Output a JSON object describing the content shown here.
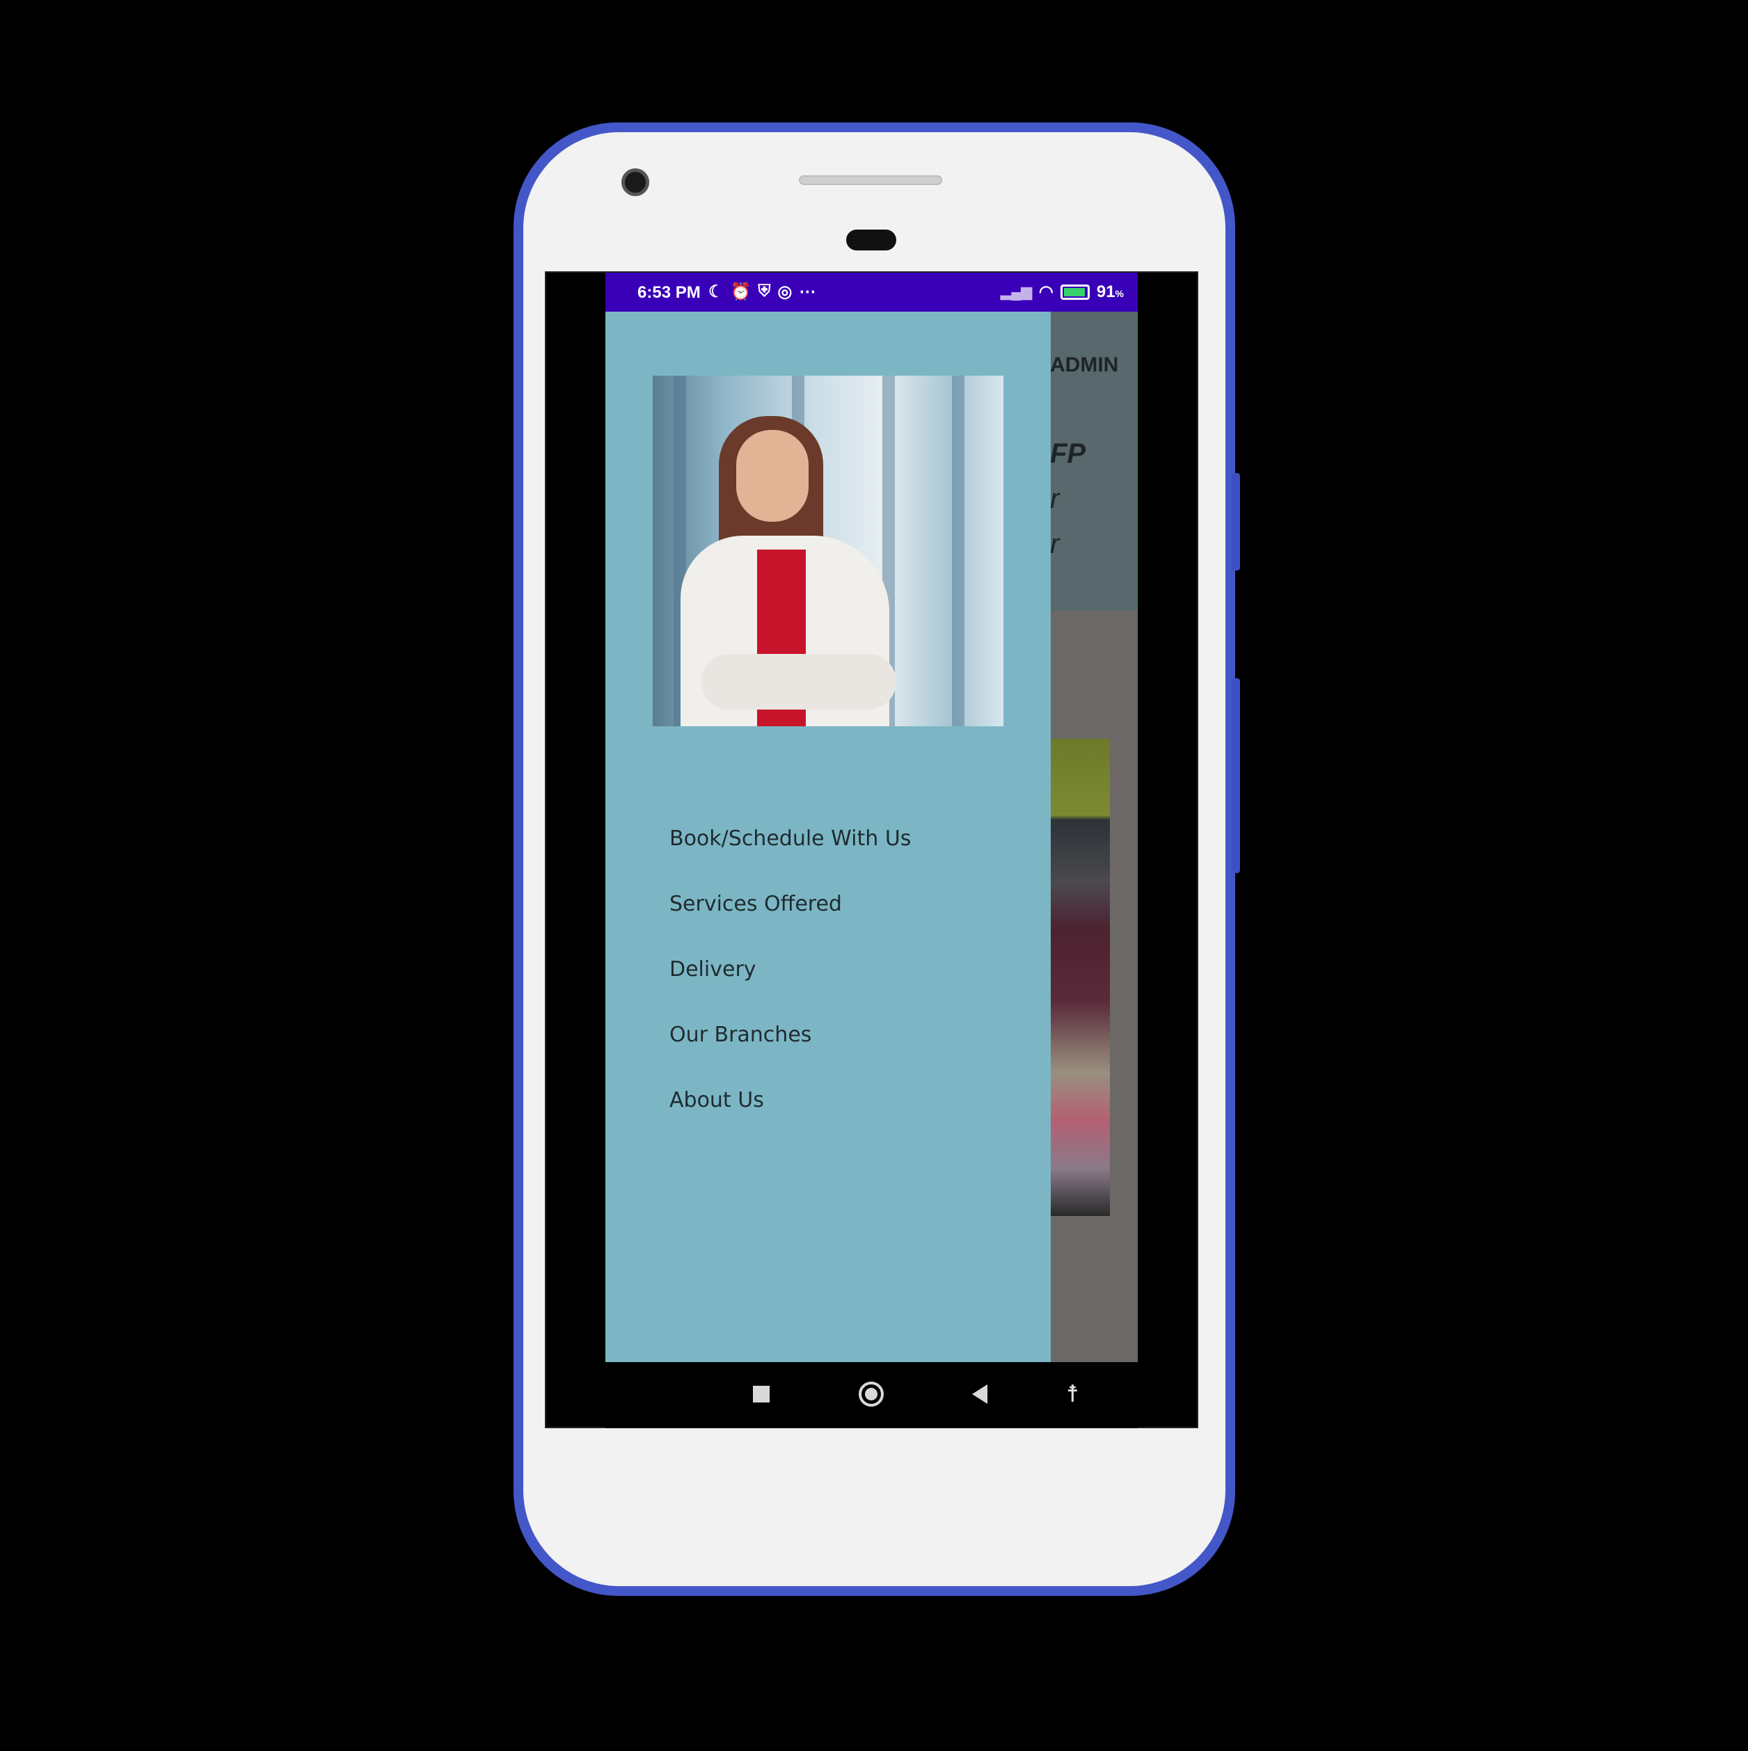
{
  "status_bar": {
    "time": "6:53 PM",
    "left_icons": [
      "moon-icon",
      "alarm-icon",
      "shield-icon",
      "data-saver-icon",
      "more-dots-icon"
    ],
    "right_icons": [
      "signal-icon",
      "wifi-icon",
      "battery-charging-icon"
    ],
    "battery_percent": "91",
    "battery_unit": "%"
  },
  "background_app": {
    "header_text": "ADMIN",
    "partial_title": "FP",
    "partial_line_1": "r",
    "partial_line_2": "r"
  },
  "drawer": {
    "menu_items": [
      {
        "label": "Book/Schedule With Us"
      },
      {
        "label": "Services Offered"
      },
      {
        "label": "Delivery"
      },
      {
        "label": "Our Branches"
      },
      {
        "label": "About Us"
      }
    ]
  },
  "colors": {
    "status_bar": "#3a00b8",
    "drawer_bg": "#7cb6c5",
    "phone_frame": "#4457c9"
  },
  "nav_bar": {
    "icons": [
      "recents-icon",
      "home-icon",
      "back-icon",
      "accessibility-icon"
    ]
  }
}
